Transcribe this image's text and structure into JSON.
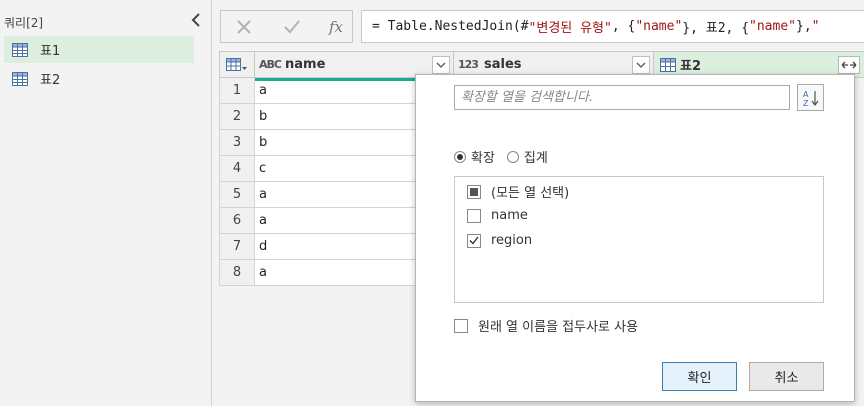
{
  "queries": {
    "title": "쿼리[2]",
    "items": [
      {
        "label": "표1",
        "active": true
      },
      {
        "label": "표2",
        "active": false
      }
    ]
  },
  "formula_bar": {
    "fx_label": "fx",
    "text_parts": [
      {
        "t": "= Table.NestedJoin(#",
        "s": false
      },
      {
        "t": "\"변경된 유형\"",
        "s": true
      },
      {
        "t": ", {",
        "s": false
      },
      {
        "t": "\"name\"",
        "s": true
      },
      {
        "t": "}, 표2, {",
        "s": false
      },
      {
        "t": "\"name\"",
        "s": true
      },
      {
        "t": "}, ",
        "s": false
      },
      {
        "t": "\"",
        "s": true
      }
    ]
  },
  "grid": {
    "columns": [
      {
        "type_icon": "ABC",
        "label": "name"
      },
      {
        "type_icon": "123",
        "label": "sales"
      },
      {
        "type_icon": "table-icon",
        "label": "표2"
      }
    ],
    "rows": [
      {
        "num": "1",
        "name": "a"
      },
      {
        "num": "2",
        "name": "b"
      },
      {
        "num": "3",
        "name": "b"
      },
      {
        "num": "4",
        "name": "c"
      },
      {
        "num": "5",
        "name": "a"
      },
      {
        "num": "6",
        "name": "a"
      },
      {
        "num": "7",
        "name": "d"
      },
      {
        "num": "8",
        "name": "a"
      }
    ]
  },
  "expand_popup": {
    "search_placeholder": "확장할 열을 검색합니다.",
    "mode_options": [
      {
        "label": "확장",
        "selected": true
      },
      {
        "label": "집계",
        "selected": false
      }
    ],
    "columns": [
      {
        "label": "(모든 열 선택)",
        "state": "partial"
      },
      {
        "label": "name",
        "state": "unchecked"
      },
      {
        "label": "region",
        "state": "checked"
      }
    ],
    "use_prefix_label": "원래 열 이름을 접두사로 사용",
    "use_prefix_checked": false,
    "ok_label": "확인",
    "cancel_label": "취소"
  },
  "colors": {
    "active_query": "#dcefdf",
    "teal_accent": "#1bad8f",
    "string_literal": "#a31515"
  }
}
